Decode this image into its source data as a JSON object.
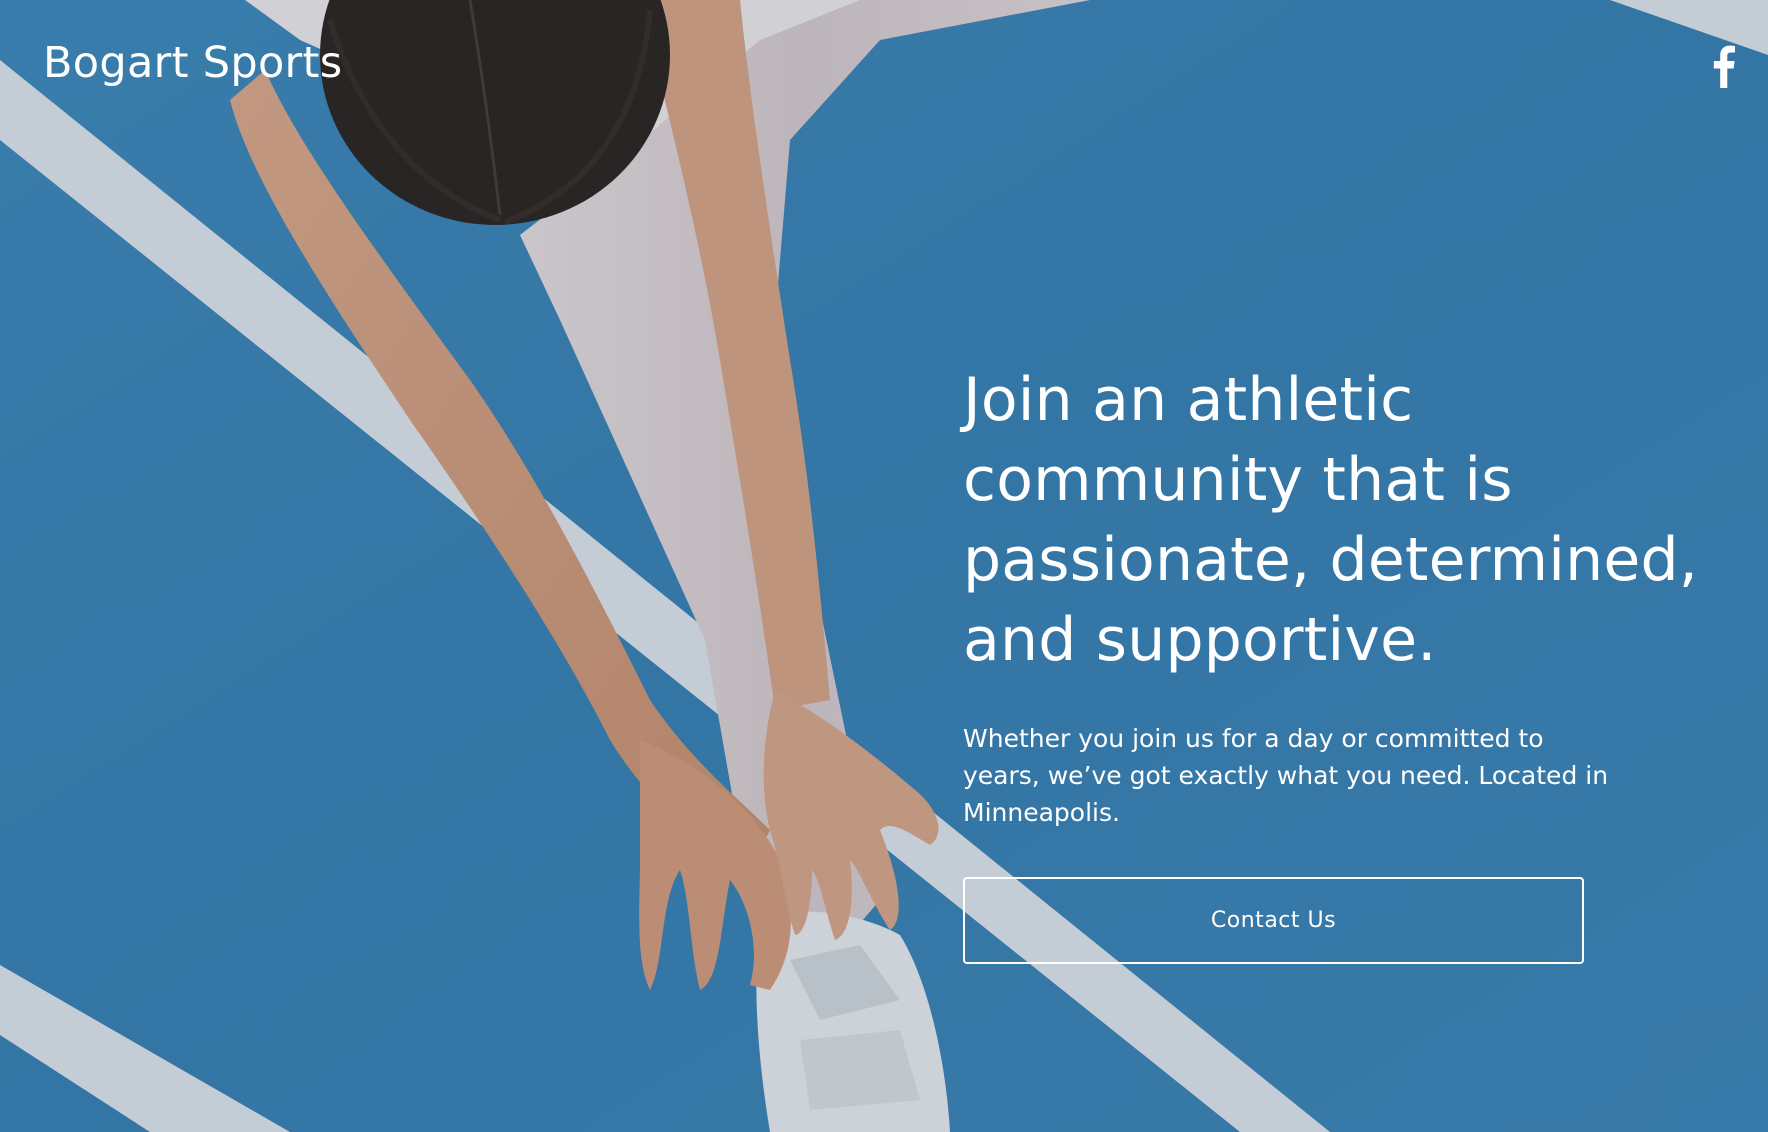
{
  "brand": {
    "name": "Bogart Sports"
  },
  "social": {
    "icon": "facebook-icon"
  },
  "hero": {
    "headline": "Join an athletic community that is passionate, determined, and supportive.",
    "subtext": "Whether you join us for a day or committed to years, we’ve got exactly what you need. Located in Minneapolis.",
    "cta_label": "Contact Us"
  },
  "colors": {
    "track_blue": "#3b82b5",
    "lane_white": "#dfe4ea",
    "text": "#ffffff"
  }
}
